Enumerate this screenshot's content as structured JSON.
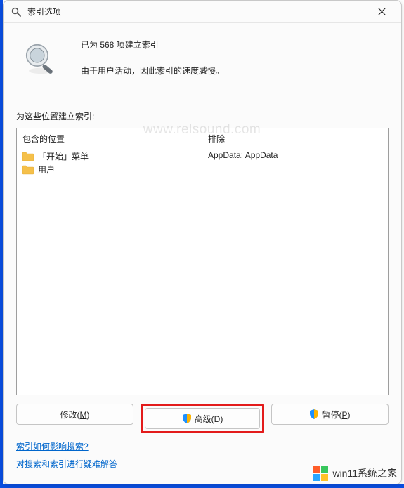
{
  "title": "索引选项",
  "status": {
    "count_line": "已为 568 项建立索引",
    "reason_line": "由于用户活动，因此索引的速度减慢。"
  },
  "locations_label": "为这些位置建立索引:",
  "columns": {
    "included": "包含的位置",
    "excluded": "排除"
  },
  "included_items": [
    {
      "label": "「开始」菜单"
    },
    {
      "label": "用户"
    }
  ],
  "excluded_items": [
    "",
    "AppData; AppData"
  ],
  "buttons": {
    "modify_pre": "修改(",
    "modify_key": "M",
    "modify_post": ")",
    "advanced_pre": "高级(",
    "advanced_key": "D",
    "advanced_post": ")",
    "pause_pre": "暂停(",
    "pause_key": "P",
    "pause_post": ")"
  },
  "links": {
    "how_affects_search": "索引如何影响搜索?",
    "troubleshoot": "对搜索和索引进行疑难解答"
  },
  "watermarks": {
    "center": "www.relsound.com",
    "corner": "win11系统之家"
  }
}
